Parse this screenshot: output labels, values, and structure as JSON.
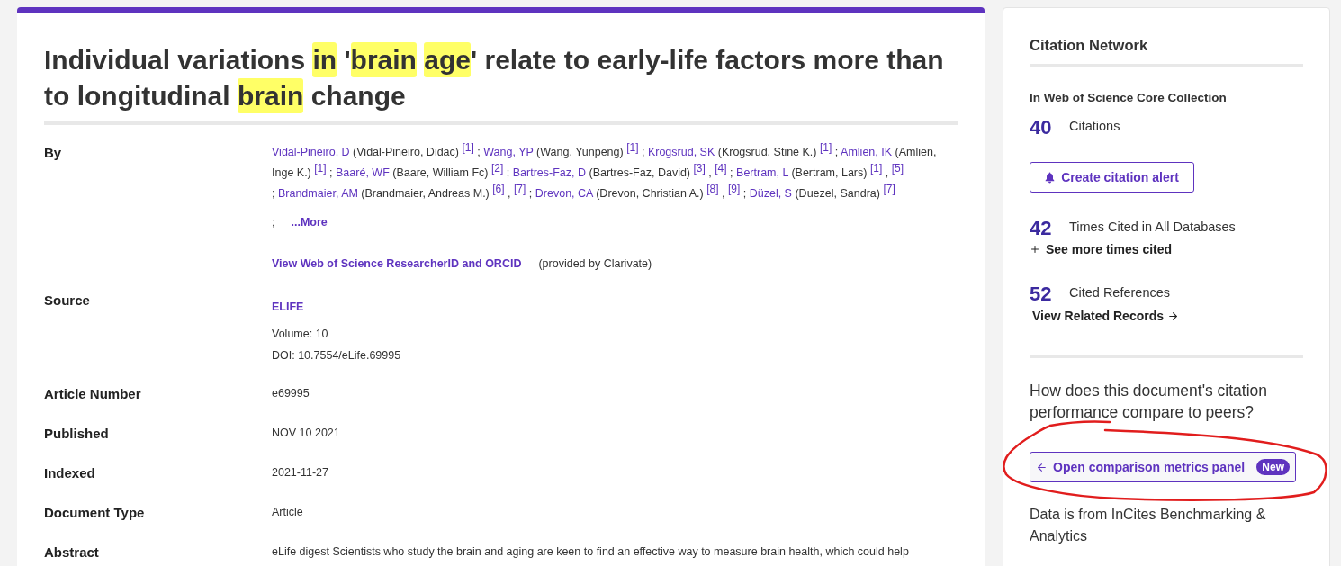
{
  "article": {
    "title_words": [
      {
        "text": "Individual variations",
        "highlighted": false
      },
      {
        "text": "in",
        "highlighted": true
      },
      {
        "prefix": "'",
        "text": "brain",
        "highlighted": true
      },
      {
        "text": "age",
        "highlighted": true,
        "suffix": "'"
      },
      {
        "text": "relate to early-life factors more than to longitudinal",
        "highlighted": false
      },
      {
        "text": "brain",
        "highlighted": true
      },
      {
        "text": "change",
        "highlighted": false
      }
    ],
    "fields": [
      {
        "kind": "authors",
        "label": "By",
        "authors": [
          {
            "name": "Vidal-Pineiro, D",
            "full_name": "(Vidal-Pineiro, Didac)",
            "affiliations": [
              {
                "label": "[1]"
              }
            ]
          },
          {
            "separator": ";",
            "name": "Wang, YP",
            "full_name": "(Wang, Yunpeng)",
            "affiliations": [
              {
                "label": "[1]"
              }
            ]
          },
          {
            "separator": ";",
            "name": "Krogsrud, SK",
            "full_name": "(Krogsrud, Stine K.)",
            "affiliations": [
              {
                "label": "[1]"
              }
            ]
          },
          {
            "separator": ";",
            "name": "Amlien, IK",
            "full_name": "(Amlien, Inge K.)",
            "affiliations": [
              {
                "label": "[1]"
              }
            ]
          },
          {
            "separator": ";",
            "name": "Baaré, WF",
            "full_name": "(Baare, William Fc)",
            "affiliations": [
              {
                "label": "[2]"
              }
            ]
          },
          {
            "separator": ";",
            "name": "Bartres-Faz, D",
            "full_name": "(Bartres-Faz, David)",
            "affiliations": [
              {
                "label": "[3]"
              },
              {
                "separator": ",",
                "label": "[4]"
              }
            ]
          },
          {
            "separator": ";",
            "name": "Bertram, L",
            "full_name": "(Bertram, Lars)",
            "affiliations": [
              {
                "label": "[1]"
              },
              {
                "separator": ",",
                "label": "[5]"
              }
            ]
          },
          {
            "separator": ";",
            "name": "Brandmaier, AM",
            "full_name": "(Brandmaier, Andreas M.)",
            "affiliations": [
              {
                "label": "[6]"
              },
              {
                "separator": ",",
                "label": "[7]"
              }
            ]
          },
          {
            "separator": ";",
            "name": "Drevon, CA",
            "full_name": "(Drevon, Christian A.)",
            "affiliations": [
              {
                "label": "[8]"
              },
              {
                "separator": ",",
                "label": "[9]"
              }
            ]
          },
          {
            "separator": ";",
            "name": "Düzel, S",
            "full_name": "(Duezel, Sandra)",
            "affiliations": [
              {
                "label": "[7]"
              }
            ]
          }
        ],
        "more": {
          "separator": ";",
          "label": "...More"
        },
        "researcher_link": "View Web of Science ResearcherID and ORCID",
        "provided_by": "(provided by Clarivate)"
      },
      {
        "kind": "source",
        "label": "Source",
        "journal": "ELIFE",
        "lines": [
          "Volume: 10",
          "DOI: 10.7554/eLife.69995"
        ]
      },
      {
        "kind": "text",
        "label": "Article Number",
        "value": "e69995"
      },
      {
        "kind": "text",
        "label": "Published",
        "value": "NOV 10 2021"
      },
      {
        "kind": "text",
        "label": "Indexed",
        "value": "2021-11-27"
      },
      {
        "kind": "text",
        "label": "Document Type",
        "value": "Article"
      },
      {
        "kind": "text",
        "label": "Abstract",
        "value": "eLife digest Scientists who study the brain and aging are keen to find an effective way to measure brain health, which could help"
      }
    ]
  },
  "citation_network": {
    "title": "Citation Network",
    "collection": "In Web of Science Core Collection",
    "items": [
      {
        "kind": "metric",
        "count": "40",
        "label": "Citations"
      },
      {
        "kind": "alert_button",
        "label": "Create citation alert"
      },
      {
        "kind": "metric",
        "count": "42",
        "label": "Times Cited in All Databases"
      },
      {
        "kind": "expand_link",
        "label": "See more times cited"
      },
      {
        "kind": "metric",
        "count": "52",
        "label": "Cited References"
      },
      {
        "kind": "forward_link",
        "label": "View Related Records"
      }
    ]
  },
  "comparison": {
    "question": "How does this document's citation performance compare to peers?",
    "button": {
      "label": "Open comparison metrics panel",
      "badge": "New"
    },
    "note": "Data is from InCites Benchmarking & Analytics"
  }
}
